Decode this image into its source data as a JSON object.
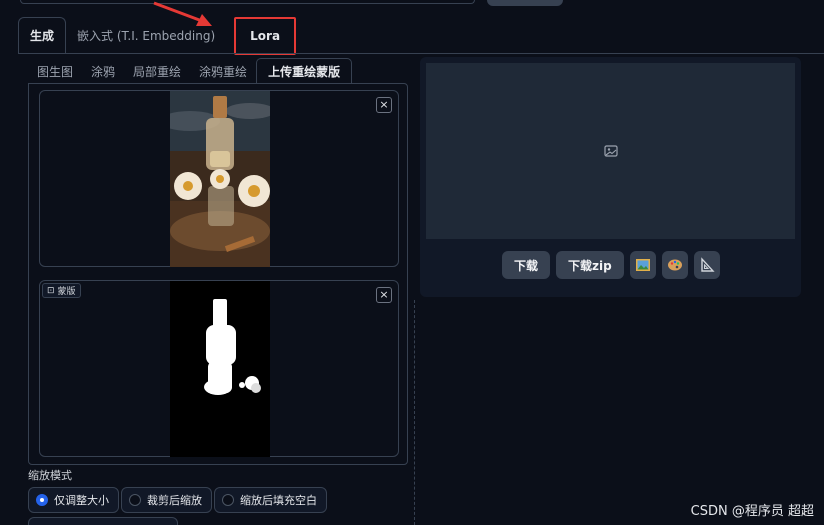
{
  "main_tabs": [
    {
      "label": "生成",
      "active": true
    },
    {
      "label": "嵌入式 (T.I. Embedding)",
      "active": false
    },
    {
      "label": "Lora",
      "highlighted": true
    }
  ],
  "sub_tabs": [
    {
      "label": "图生图"
    },
    {
      "label": "涂鸦"
    },
    {
      "label": "局部重绘"
    },
    {
      "label": "涂鸦重绘"
    },
    {
      "label": "上传重绘蒙版",
      "active": true
    }
  ],
  "mask_label": "蒙版",
  "close_glyph": "×",
  "scale_mode": {
    "title": "缩放模式",
    "options": [
      {
        "label": "仅调整大小",
        "checked": true
      },
      {
        "label": "裁剪后缩放",
        "checked": false
      },
      {
        "label": "缩放后填充空白",
        "checked": false
      }
    ]
  },
  "output": {
    "buttons": {
      "download": "下载",
      "download_zip": "下载zip"
    },
    "icon_buttons": [
      "image-icon",
      "palette-icon",
      "ruler-icon"
    ]
  },
  "watermark": "CSDN @程序员 超超",
  "colors": {
    "highlight": "#e53935",
    "accent": "#2563eb"
  }
}
